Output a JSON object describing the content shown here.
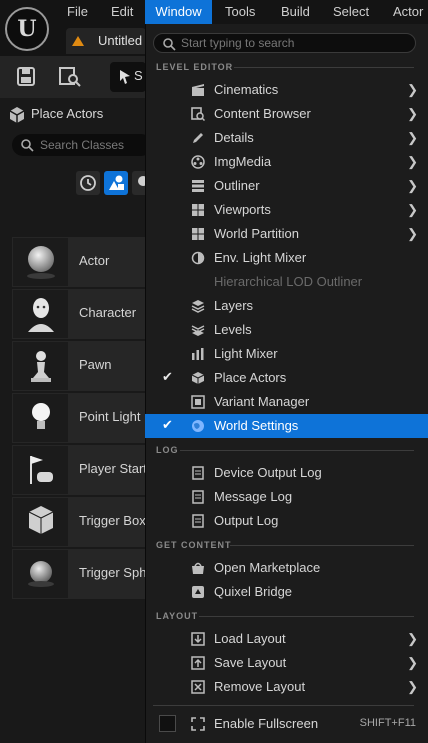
{
  "menubar": {
    "items": [
      "File",
      "Edit",
      "Window",
      "Tools",
      "Build",
      "Select",
      "Actor"
    ],
    "active": "Window"
  },
  "tab": {
    "title": "Untitled"
  },
  "toolbar": {
    "mode_label": "S"
  },
  "left_panel": {
    "title": "Place Actors",
    "search_placeholder": "Search Classes",
    "actors": [
      "Actor",
      "Character",
      "Pawn",
      "Point Light",
      "Player Start",
      "Trigger Box",
      "Trigger Sphere"
    ]
  },
  "dropdown": {
    "search_placeholder": "Start typing to search",
    "sections": {
      "level_editor": "LEVEL EDITOR",
      "log": "LOG",
      "get_content": "GET CONTENT",
      "layout": "LAYOUT"
    },
    "level_editor_items": [
      {
        "label": "Cinematics",
        "icon": "cinematics-icon",
        "submenu": true
      },
      {
        "label": "Content Browser",
        "icon": "content-browser-icon",
        "submenu": true
      },
      {
        "label": "Details",
        "icon": "details-icon",
        "submenu": true
      },
      {
        "label": "ImgMedia",
        "icon": "imgmedia-icon",
        "submenu": true
      },
      {
        "label": "Outliner",
        "icon": "outliner-icon",
        "submenu": true
      },
      {
        "label": "Viewports",
        "icon": "viewports-icon",
        "submenu": true
      },
      {
        "label": "World Partition",
        "icon": "world-partition-icon",
        "submenu": true
      },
      {
        "label": "Env. Light Mixer",
        "icon": "env-light-mixer-icon"
      },
      {
        "label": "Hierarchical LOD Outliner",
        "icon": "",
        "disabled": true
      },
      {
        "label": "Layers",
        "icon": "layers-icon"
      },
      {
        "label": "Levels",
        "icon": "levels-icon"
      },
      {
        "label": "Light Mixer",
        "icon": "light-mixer-icon"
      },
      {
        "label": "Place Actors",
        "icon": "place-actors-icon",
        "checked": true
      },
      {
        "label": "Variant Manager",
        "icon": "variant-manager-icon"
      },
      {
        "label": "World Settings",
        "icon": "world-settings-icon",
        "checked": true,
        "highlighted": true
      }
    ],
    "log_items": [
      "Device Output Log",
      "Message Log",
      "Output Log"
    ],
    "content_items": [
      "Open Marketplace",
      "Quixel Bridge"
    ],
    "layout_items": [
      "Load Layout",
      "Save Layout",
      "Remove Layout"
    ],
    "fullscreen": {
      "label": "Enable Fullscreen",
      "shortcut": "SHIFT+F11"
    }
  },
  "colors": {
    "accent": "#0e73d8",
    "background": "#1c1c1c",
    "warning": "#e08a12"
  }
}
